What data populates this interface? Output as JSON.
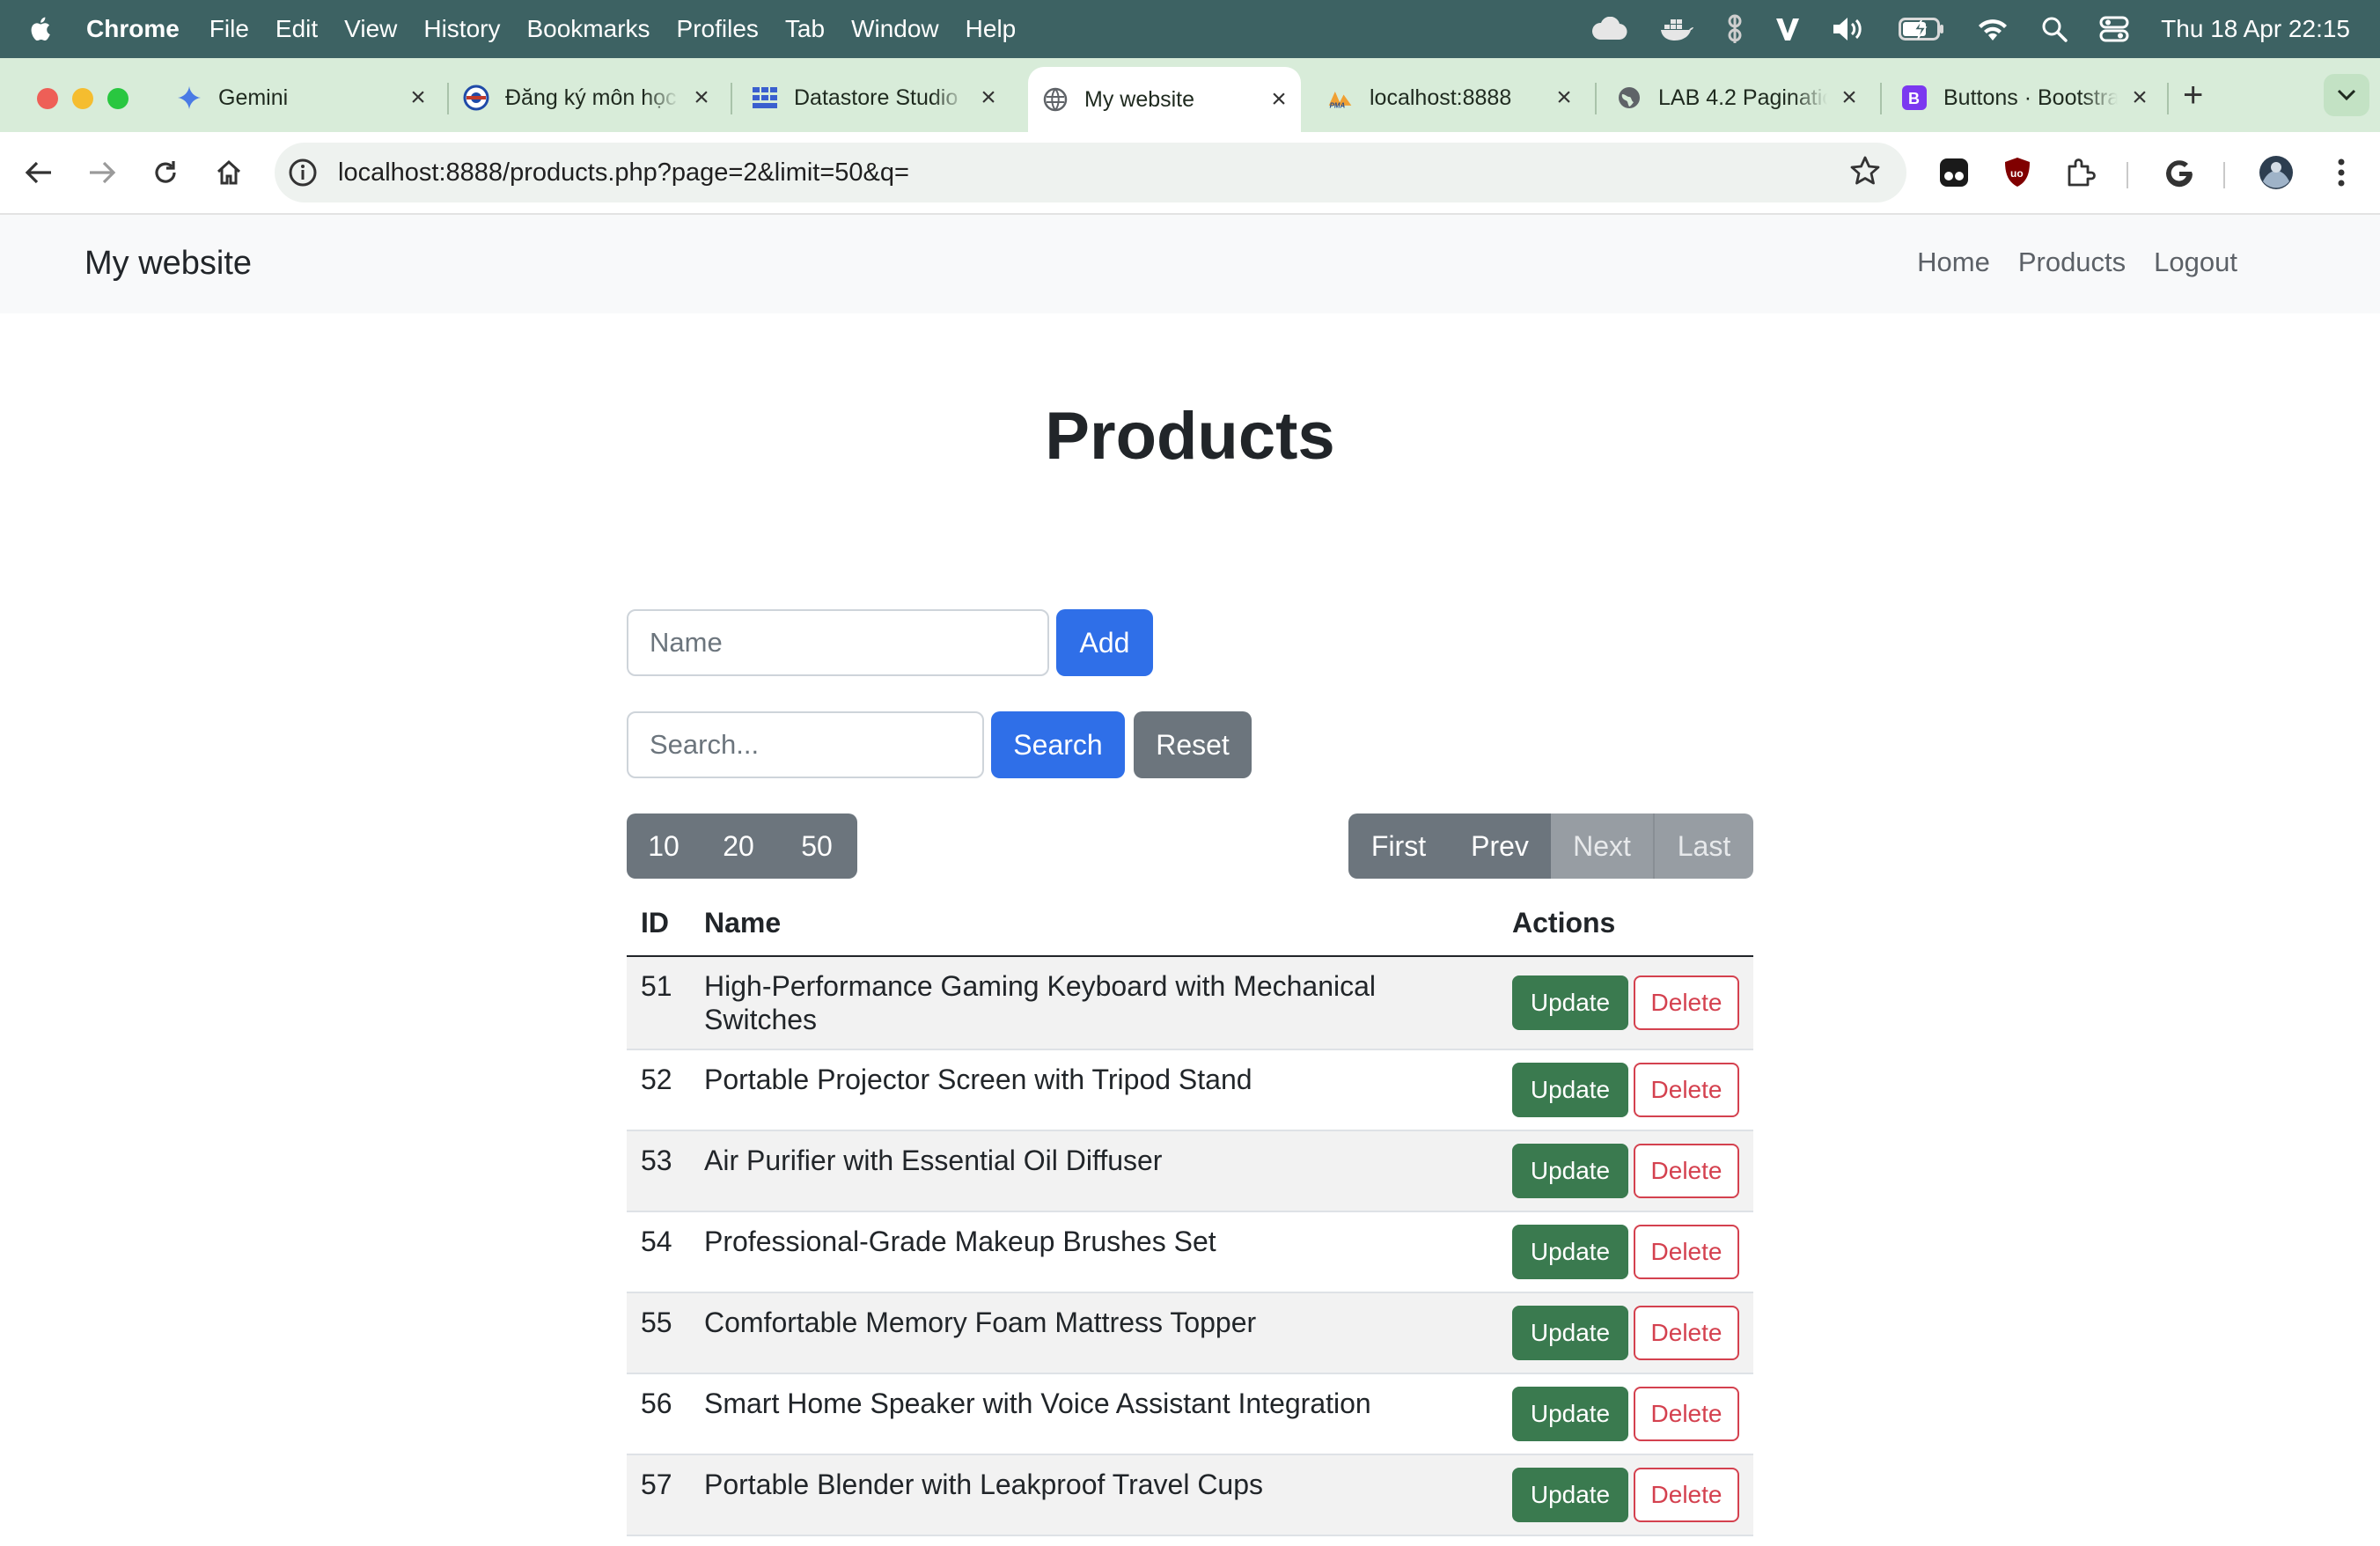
{
  "menubar": {
    "app_name": "Chrome",
    "items": [
      "File",
      "Edit",
      "View",
      "History",
      "Bookmarks",
      "Profiles",
      "Tab",
      "Window",
      "Help"
    ],
    "clock": "Thu 18 Apr  22:15"
  },
  "tabs": [
    {
      "title": "Gemini",
      "icon": "gemini-sparkle-icon",
      "active": false
    },
    {
      "title": "Đăng ký môn học",
      "icon": "university-logo-icon",
      "active": false
    },
    {
      "title": "Datastore Studio",
      "icon": "datastore-grid-icon",
      "active": false
    },
    {
      "title": "My website",
      "icon": "globe-icon",
      "active": true
    },
    {
      "title": "localhost:8888",
      "icon": "phpmyadmin-icon",
      "active": false
    },
    {
      "title": "LAB 4.2 Pagination",
      "icon": "globe-icon",
      "active": false
    },
    {
      "title": "Buttons · Bootstrap",
      "icon": "bootstrap-icon",
      "active": false
    }
  ],
  "address_bar": {
    "url": "localhost:8888/products.php?page=2&limit=50&q="
  },
  "colors": {
    "menubar_bg": "#3d6263",
    "tabstrip_bg": "#d8ecd9",
    "primary": "#2f6fe8",
    "secondary": "#6c757d",
    "success": "#3a7a4f",
    "danger": "#d4414f"
  },
  "site": {
    "brand": "My website",
    "nav": [
      "Home",
      "Products",
      "Logout"
    ]
  },
  "page": {
    "title": "Products",
    "add_form": {
      "placeholder": "Name",
      "button": "Add"
    },
    "search_form": {
      "placeholder": "Search...",
      "search_button": "Search",
      "reset_button": "Reset"
    },
    "limits": [
      "10",
      "20",
      "50"
    ],
    "pagination": {
      "first": "First",
      "prev": "Prev",
      "next": "Next",
      "last": "Last"
    }
  },
  "table": {
    "headers": {
      "id": "ID",
      "name": "Name",
      "actions": "Actions"
    },
    "update_label": "Update",
    "delete_label": "Delete",
    "rows": [
      {
        "id": "51",
        "name": "High-Performance Gaming Keyboard with Mechanical Switches"
      },
      {
        "id": "52",
        "name": "Portable Projector Screen with Tripod Stand"
      },
      {
        "id": "53",
        "name": "Air Purifier with Essential Oil Diffuser"
      },
      {
        "id": "54",
        "name": "Professional-Grade Makeup Brushes Set"
      },
      {
        "id": "55",
        "name": "Comfortable Memory Foam Mattress Topper"
      },
      {
        "id": "56",
        "name": "Smart Home Speaker with Voice Assistant Integration"
      },
      {
        "id": "57",
        "name": "Portable Blender with Leakproof Travel Cups"
      }
    ]
  }
}
